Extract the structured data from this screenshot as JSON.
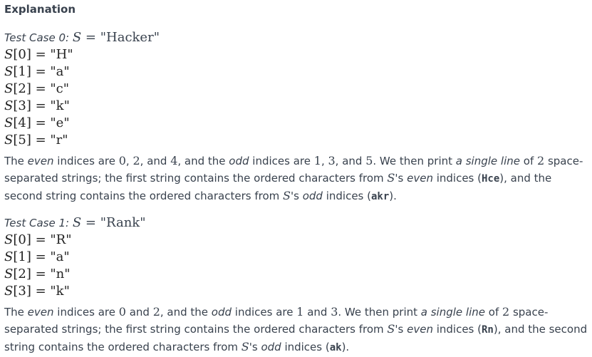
{
  "heading": "Explanation",
  "cases": [
    {
      "label": "Test Case 0:",
      "var": "S",
      "word": "Hacker",
      "chars": [
        {
          "idx": "0",
          "ch": "H"
        },
        {
          "idx": "1",
          "ch": "a"
        },
        {
          "idx": "2",
          "ch": "c"
        },
        {
          "idx": "3",
          "ch": "k"
        },
        {
          "idx": "4",
          "ch": "e"
        },
        {
          "idx": "5",
          "ch": "r"
        }
      ],
      "para": {
        "p1": "The ",
        "even_word": "even",
        "p2": " indices are ",
        "even_list": [
          "0",
          "2",
          "4"
        ],
        "p3": ", and the ",
        "odd_word": "odd",
        "p4": " indices are ",
        "odd_list": [
          "1",
          "3",
          "5"
        ],
        "p5": ". We then print ",
        "single_line": "a single line",
        "p6": " of ",
        "count": "2",
        "p7": " space-separated strings; the first string contains the ordered characters from ",
        "p8": "'s ",
        "p9": " indices (",
        "even_result": "Hce",
        "p10": "), and the second string contains the ordered characters from ",
        "p11": "'s ",
        "p12": " indices (",
        "odd_result": "akr",
        "p13": ")."
      }
    },
    {
      "label": "Test Case 1:",
      "var": "S",
      "word": "Rank",
      "chars": [
        {
          "idx": "0",
          "ch": "R"
        },
        {
          "idx": "1",
          "ch": "a"
        },
        {
          "idx": "2",
          "ch": "n"
        },
        {
          "idx": "3",
          "ch": "k"
        }
      ],
      "para": {
        "p1": "The ",
        "even_word": "even",
        "p2": " indices are ",
        "even_list": [
          "0",
          "2"
        ],
        "p3": ", and the ",
        "odd_word": "odd",
        "p4": " indices are ",
        "odd_list": [
          "1",
          "3"
        ],
        "p5": ". We then print ",
        "single_line": "a single line",
        "p6": " of ",
        "count": "2",
        "p7": " space-separated strings; the first string contains the ordered characters from ",
        "p8": "'s ",
        "p9": " indices (",
        "even_result": "Rn",
        "p10": "), and the second string contains the ordered characters from ",
        "p11": "'s ",
        "p12": " indices (",
        "odd_result": "ak",
        "p13": ")."
      }
    }
  ]
}
